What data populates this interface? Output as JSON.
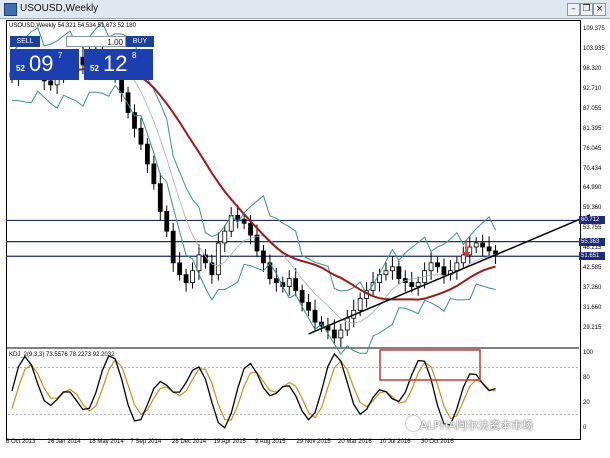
{
  "window": {
    "title": "USOUSD,Weekly"
  },
  "chart_header": "USOUSD,Weekly  54.321 54.534 51.673 52.180",
  "trade_panel": {
    "sell_label": "SELL",
    "buy_label": "BUY",
    "lot_value": "1.00",
    "sell_price": {
      "prefix": "52",
      "big": "09",
      "sup": "7"
    },
    "buy_price": {
      "prefix": "52",
      "big": "12",
      "sup": "8"
    }
  },
  "kdj_header": "KDJ_2(9,3,3) 73.5576 78.2273 92.2032",
  "y_axis": {
    "labels": [
      "109.375",
      "103.935",
      "98.320",
      "92.710",
      "87.055",
      "81.395",
      "76.045",
      "70.434",
      "64.990",
      "59.360",
      "53.755",
      "48.215",
      "42.585",
      "37.260",
      "31.660",
      "29.215"
    ],
    "badges": [
      "60.712",
      "55.363",
      "51.651"
    ],
    "kdj_labels": [
      "100",
      "80",
      "20",
      "0"
    ]
  },
  "x_axis": {
    "labels": [
      "6 Oct 2013",
      "26 Jan 2014",
      "18 May 2014",
      "7 Sep 2014",
      "28 Dec 2014",
      "19 Apr 2015",
      "9 Aug 2015",
      "29 Nov 2015",
      "20 Mar 2016",
      "10 Jul 2016",
      "30 Oct 2016"
    ]
  },
  "colors": {
    "candle": "#000000",
    "ma_red": "#a01818",
    "bollinger": "#3a8f8f",
    "hline": "#1f2a7a",
    "trendline": "#000000",
    "kdj_k": "#000000",
    "kdj_d": "#c8901a",
    "highlight_box": "#d2332f",
    "arrow": "#d2332f"
  },
  "chart_data": {
    "type": "candlestick",
    "series_name": "USOUSD Weekly",
    "x_range": [
      "6 Oct 2013",
      "30 Oct 2016"
    ],
    "ylim": [
      29.215,
      109.375
    ],
    "close": [
      97,
      99,
      100,
      102,
      99,
      96,
      95,
      97,
      99,
      101,
      102,
      100,
      103,
      104,
      101,
      99,
      97,
      93,
      88,
      84,
      80,
      75,
      70,
      63,
      58,
      50,
      47,
      45,
      48,
      52,
      50,
      47,
      55,
      58,
      62,
      61,
      60,
      57,
      53,
      50,
      46,
      45,
      44,
      46,
      43,
      40,
      38,
      35,
      34,
      33,
      31,
      33,
      36,
      38,
      41,
      43,
      45,
      47,
      48,
      49,
      46,
      45,
      44,
      45,
      48,
      50,
      49,
      47,
      48,
      50,
      52,
      54,
      55,
      54,
      53,
      52
    ],
    "horizontal_levels": [
      60.712,
      55.363,
      51.651
    ],
    "trendline": {
      "from": {
        "date": "29 Nov 2015",
        "price": 32
      },
      "to": {
        "date": "30 Oct 2016",
        "price": 52
      }
    },
    "kdj": {
      "k": 73.5576,
      "d": 78.2273,
      "j": 92.2032,
      "range": [
        0,
        100
      ]
    }
  },
  "watermark": "ALPHA阿尔法资本市场"
}
